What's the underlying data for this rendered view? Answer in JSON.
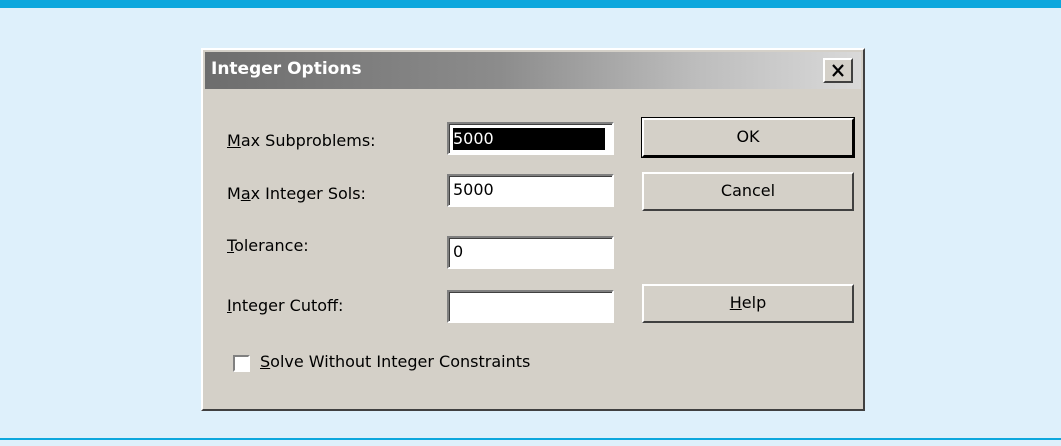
{
  "dialog": {
    "title": "Integer Options",
    "close_icon": "close-icon"
  },
  "fields": [
    {
      "label_mnemonic": "M",
      "label_rest": "ax Subproblems:",
      "value": "5000",
      "selected": true
    },
    {
      "label_pre": "M",
      "label_mnemonic": "a",
      "label_rest": "x Integer Sols:",
      "value": "5000"
    },
    {
      "label_mnemonic": "T",
      "label_rest": "olerance:",
      "value": "0"
    },
    {
      "label_mnemonic": "I",
      "label_rest": "nteger Cutoff:",
      "value": ""
    }
  ],
  "buttons": {
    "ok": "OK",
    "cancel": "Cancel",
    "help_mnemonic": "H",
    "help_rest": "elp"
  },
  "checkbox": {
    "mnemonic": "S",
    "rest": "olve Without Integer Constraints",
    "checked": false
  }
}
